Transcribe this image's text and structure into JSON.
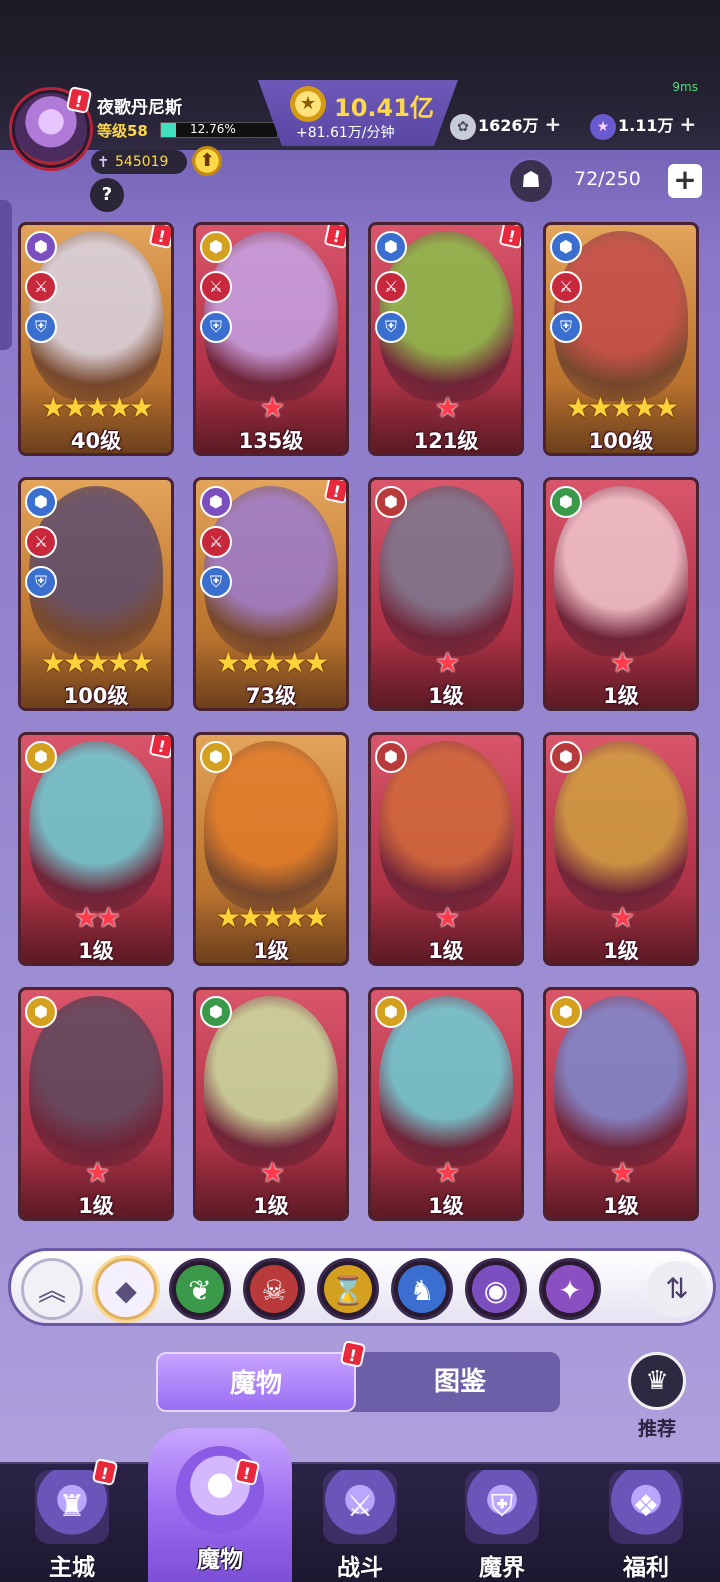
{
  "status": {
    "ping": "9ms"
  },
  "player": {
    "name": "夜歌丹尼斯",
    "level_text": "等级58",
    "xp_percent_text": "12.76%",
    "xp_fraction": 0.1276,
    "power": "545019",
    "help_glyph": "?",
    "alert_glyph": "!"
  },
  "currency": {
    "gold_amount": "10.41亿",
    "gold_rate": "+81.61万/分钟",
    "resource1": "1626万",
    "resource2": "1.11万",
    "plus_glyph": "+"
  },
  "capacity": {
    "text": "72/250",
    "plus_glyph": "+"
  },
  "cards": [
    {
      "level": "40级",
      "stars": "★★★★★",
      "rarity": "gold",
      "art": "#d8d4e6",
      "badges": [
        "#7b4fc0",
        "#c8283c",
        "#3a6fd0"
      ],
      "alert": true
    },
    {
      "level": "135级",
      "stars": "★",
      "rarity": "red",
      "art": "#c4a4e6",
      "badges": [
        "#d4a020",
        "#c8283c",
        "#3a6fd0"
      ],
      "alert": true
    },
    {
      "level": "121级",
      "stars": "★",
      "rarity": "red",
      "art": "#8ac04a",
      "badges": [
        "#3a6fd0",
        "#c8283c",
        "#3a6fd0"
      ],
      "alert": true
    },
    {
      "level": "100级",
      "stars": "★★★★★",
      "rarity": "gold",
      "art": "#c24a4a",
      "badges": [
        "#3a6fd0",
        "#c8283c",
        "#3a6fd0"
      ],
      "alert": false
    },
    {
      "level": "100级",
      "stars": "★★★★★",
      "rarity": "gold",
      "art": "#5a4a6e",
      "badges": [
        "#3a6fd0",
        "#c8283c",
        "#3a6fd0"
      ],
      "alert": false
    },
    {
      "level": "73级",
      "stars": "★★★★★",
      "rarity": "gold",
      "art": "#9a7ad0",
      "badges": [
        "#7b4fc0",
        "#c8283c",
        "#3a6fd0"
      ],
      "alert": true
    },
    {
      "level": "1级",
      "stars": "★",
      "rarity": "red",
      "art": "#7a7a90",
      "badges": [
        "#b83a3a"
      ],
      "alert": false
    },
    {
      "level": "1级",
      "stars": "★",
      "rarity": "red",
      "art": "#f0c8d0",
      "badges": [
        "#3a9a4a"
      ],
      "alert": false
    },
    {
      "level": "1级",
      "stars": "★★",
      "rarity": "red",
      "art": "#6ad0d8",
      "badges": [
        "#d4a020"
      ],
      "alert": true
    },
    {
      "level": "1级",
      "stars": "★★★★★",
      "rarity": "gold",
      "art": "#e07a28",
      "badges": [
        "#d4a020"
      ],
      "alert": false
    },
    {
      "level": "1级",
      "stars": "★",
      "rarity": "red",
      "art": "#d06a3a",
      "badges": [
        "#b83a3a"
      ],
      "alert": false
    },
    {
      "level": "1级",
      "stars": "★",
      "rarity": "red",
      "art": "#d0a040",
      "badges": [
        "#b83a3a"
      ],
      "alert": false
    },
    {
      "level": "1级",
      "stars": "★",
      "rarity": "red",
      "art": "#5a4a5e",
      "badges": [
        "#d4a020"
      ],
      "alert": false
    },
    {
      "level": "1级",
      "stars": "★",
      "rarity": "red",
      "art": "#c8e0a0",
      "badges": [
        "#3a9a4a"
      ],
      "alert": false
    },
    {
      "level": "1级",
      "stars": "★",
      "rarity": "red",
      "art": "#6ad0d8",
      "badges": [
        "#d4a020"
      ],
      "alert": false
    },
    {
      "level": "1级",
      "stars": "★",
      "rarity": "red",
      "art": "#7a8ad0",
      "badges": [
        "#d4a020"
      ],
      "alert": false
    }
  ],
  "filters": [
    {
      "name": "collapse-up-icon",
      "glyph": "︽",
      "color": "#f2f0f6"
    },
    {
      "name": "all-elements-icon",
      "glyph": "◆",
      "color": "#f4f0ff"
    },
    {
      "name": "nature-element-icon",
      "glyph": "❦",
      "color": "#3a9a4a"
    },
    {
      "name": "beast-element-icon",
      "glyph": "☠",
      "color": "#b83a3a"
    },
    {
      "name": "time-element-icon",
      "glyph": "⌛",
      "color": "#d4a020"
    },
    {
      "name": "dragon-element-icon",
      "glyph": "♞",
      "color": "#3a6fd0"
    },
    {
      "name": "eye-element-icon",
      "glyph": "◉",
      "color": "#7b4fc0"
    },
    {
      "name": "spiral-element-icon",
      "glyph": "✦",
      "color": "#8a4fc0"
    }
  ],
  "sort_glyph": "⇅",
  "tabs": {
    "active": "魔物",
    "inactive": "图鉴"
  },
  "recommend": {
    "label": "推荐",
    "glyph": "♛"
  },
  "nav": [
    {
      "label": "主城",
      "glyph": "♜"
    },
    {
      "label": "魔物",
      "glyph": "✦"
    },
    {
      "label": "战斗",
      "glyph": "⚔"
    },
    {
      "label": "魔界",
      "glyph": "⛨"
    },
    {
      "label": "福利",
      "glyph": "❖"
    }
  ],
  "colors": {
    "accent_gold": "#ffd84a",
    "alert_red": "#e8283c",
    "primary_purple": "#9a6ef2"
  }
}
